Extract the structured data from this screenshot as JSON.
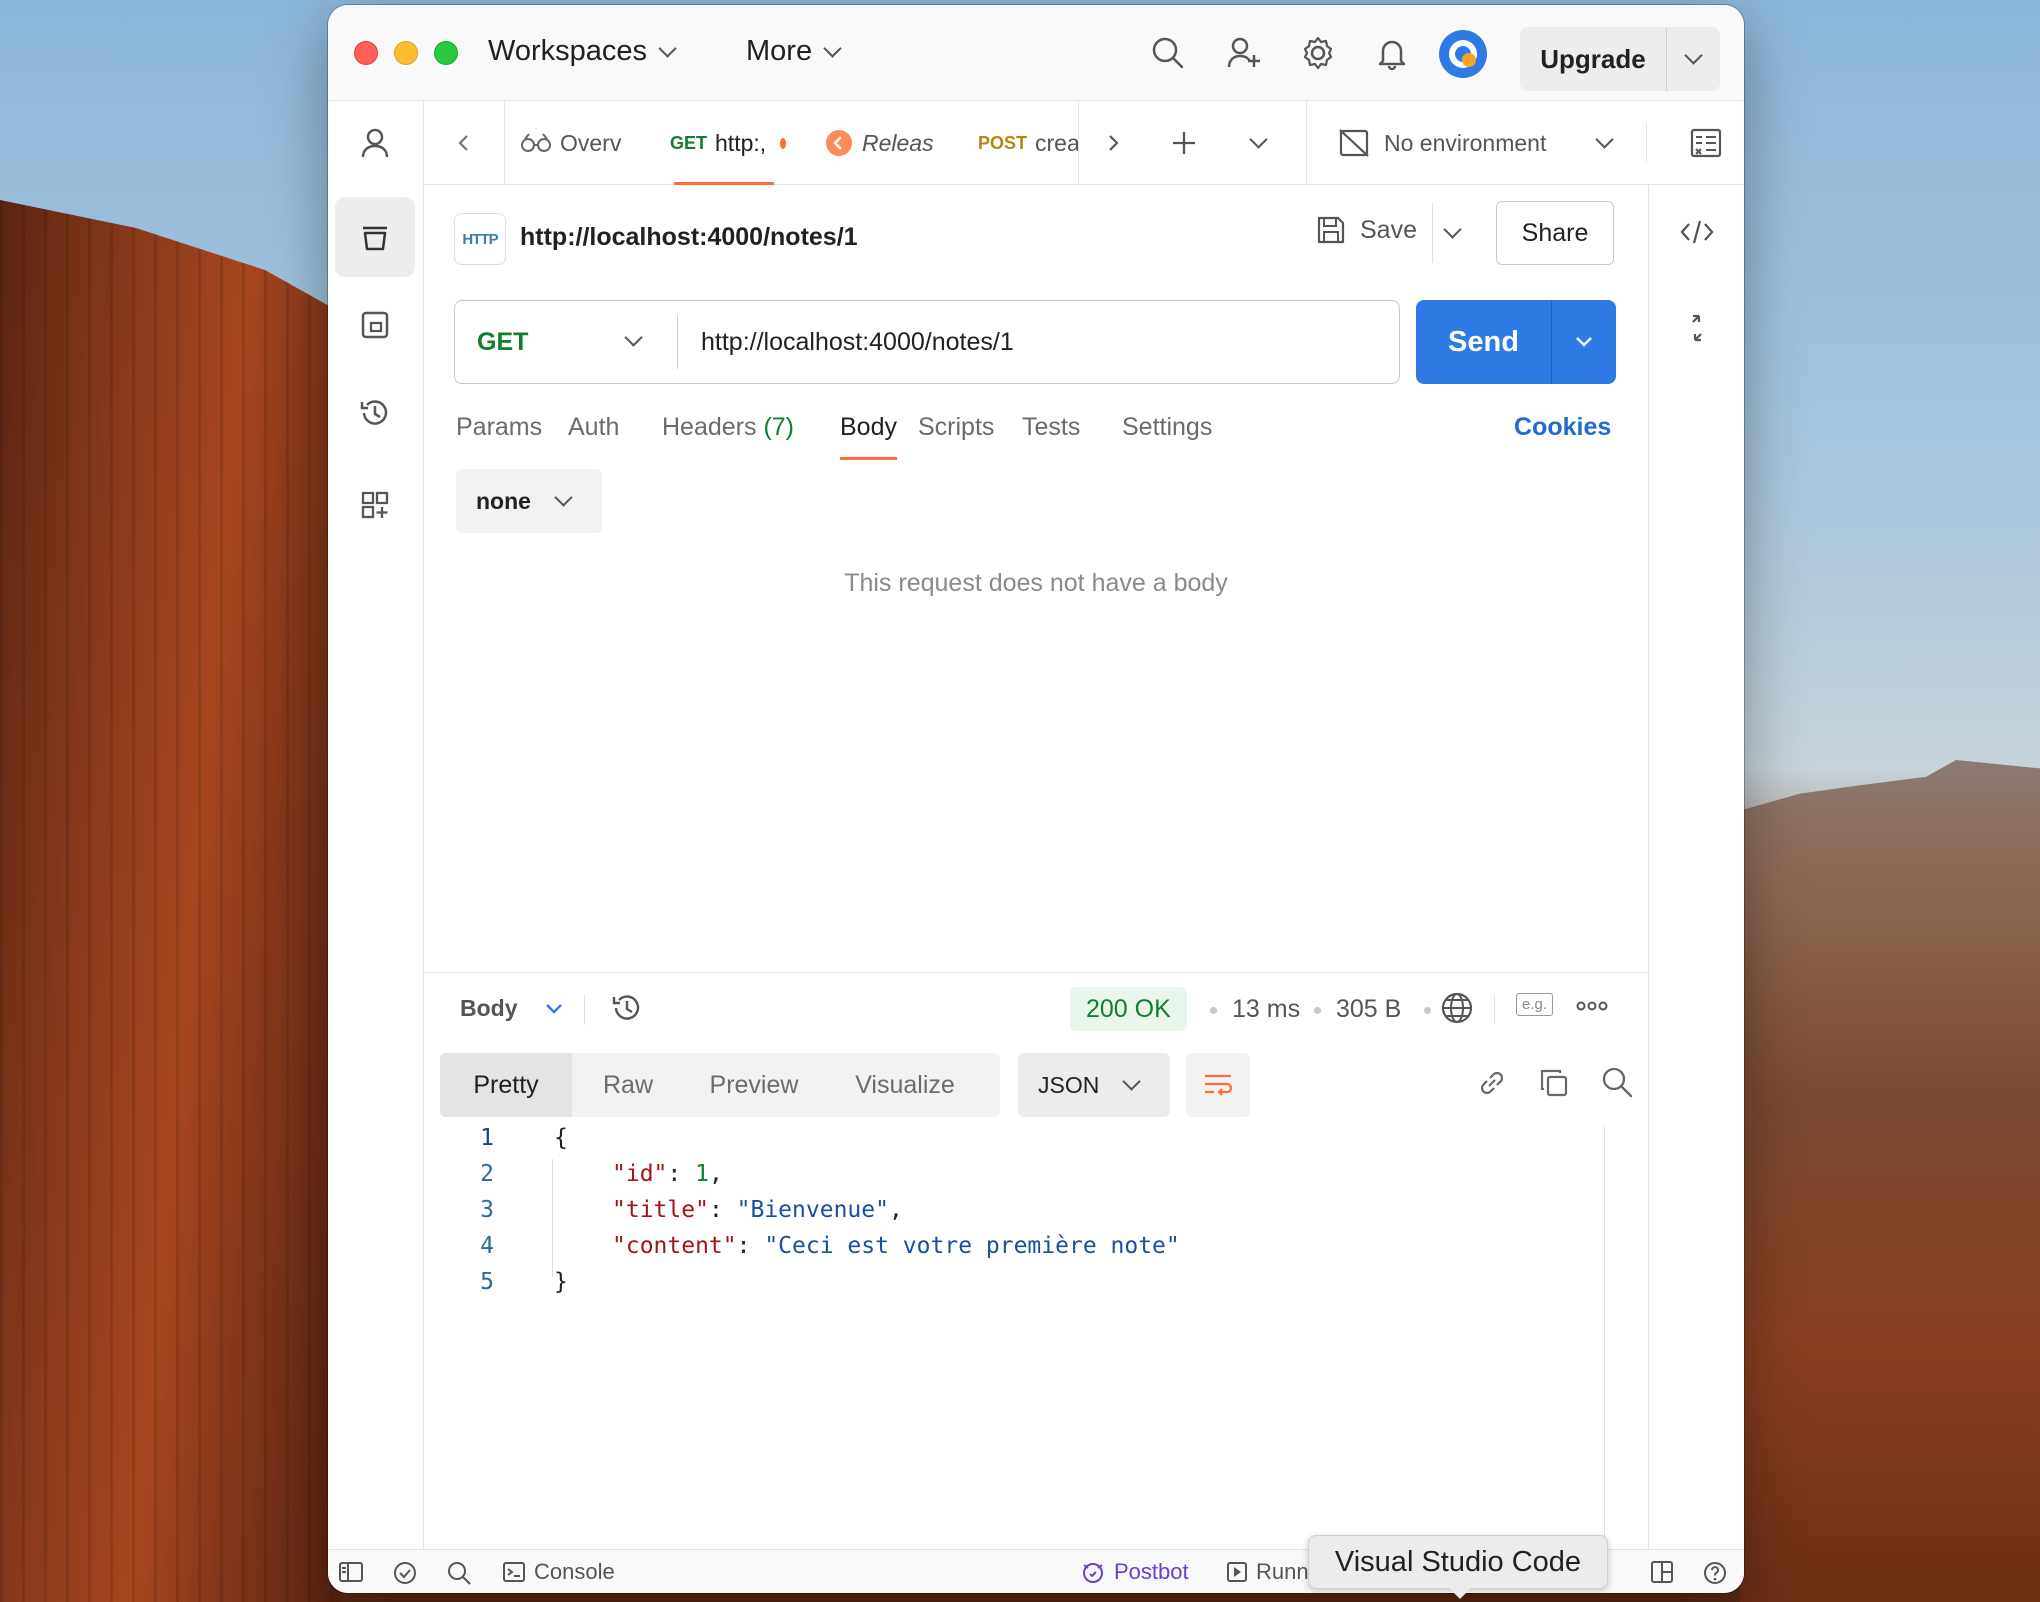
{
  "titlebar": {
    "menu": [
      {
        "label": "Workspaces"
      },
      {
        "label": "More"
      }
    ],
    "icons": [
      "search-icon",
      "invite-icon",
      "gear-icon",
      "bell-icon",
      "avatar"
    ],
    "upgrade_label": "Upgrade"
  },
  "tabs": [
    {
      "method": "",
      "label": "Overv",
      "icon": "overview-icon"
    },
    {
      "method": "GET",
      "label": "http:,",
      "active": true,
      "unsaved": true
    },
    {
      "method": "",
      "label": "Releas",
      "icon": "release-icon"
    },
    {
      "method": "POST",
      "label": "crea"
    }
  ],
  "environment": {
    "label": "No environment"
  },
  "request": {
    "title": "http://localhost:4000/notes/1",
    "badge": "HTTP",
    "save_label": "Save",
    "share_label": "Share",
    "method": "GET",
    "url": "http://localhost:4000/notes/1",
    "send_label": "Send",
    "tabs": [
      {
        "label": "Params"
      },
      {
        "label": "Auth"
      },
      {
        "label": "Headers",
        "count": "(7)"
      },
      {
        "label": "Body",
        "active": true
      },
      {
        "label": "Scripts"
      },
      {
        "label": "Tests"
      },
      {
        "label": "Settings"
      }
    ],
    "cookies_label": "Cookies",
    "body_type": "none",
    "empty_body_text": "This request does not have a body"
  },
  "response": {
    "section_label": "Body",
    "status": "200 OK",
    "time": "13 ms",
    "size": "305 B",
    "eg_label": "e.g.",
    "views": [
      {
        "label": "Pretty",
        "active": true
      },
      {
        "label": "Raw"
      },
      {
        "label": "Preview"
      },
      {
        "label": "Visualize"
      }
    ],
    "format": "JSON",
    "lines": [
      {
        "no": "1",
        "text": "{"
      },
      {
        "no": "2",
        "key": "\"id\"",
        "value": "1",
        "value_type": "number"
      },
      {
        "no": "3",
        "key": "\"title\"",
        "value": "\"Bienvenue\"",
        "value_type": "string"
      },
      {
        "no": "4",
        "key": "\"content\"",
        "value": "\"Ceci est votre première note\"",
        "value_type": "string"
      },
      {
        "no": "5",
        "text": "}"
      }
    ]
  },
  "statusbar": {
    "console_label": "Console",
    "postbot_label": "Postbot",
    "runner_label": "Runn"
  },
  "tooltip": "Visual Studio Code",
  "colors": {
    "accent": "#ff6c37",
    "send": "#2f7be6",
    "get": "#0f7f2e",
    "post": "#b8860b",
    "link": "#1f6bd1"
  }
}
